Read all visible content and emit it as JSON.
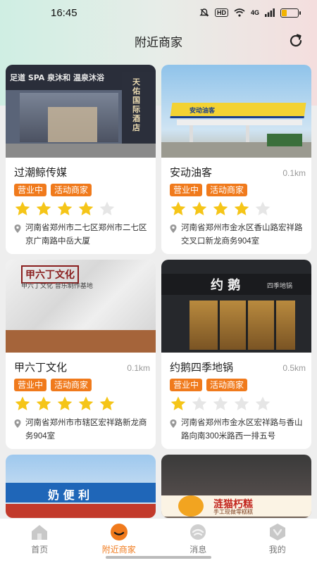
{
  "status_bar": {
    "time": "16:45",
    "hd": "HD",
    "network": "4G"
  },
  "header": {
    "title": "附近商家"
  },
  "merchants": [
    {
      "name": "过潮鲸传媒",
      "distance": "",
      "tags": [
        "营业中",
        "活动商家"
      ],
      "rating": 4,
      "address": "河南省郑州市二七区郑州市二七区京广南路中岳大厦"
    },
    {
      "name": "安动油客",
      "distance": "0.1km",
      "tags": [
        "营业中",
        "活动商家"
      ],
      "rating": 4,
      "address": "河南省郑州市金水区香山路宏祥路交叉口新龙商务904室"
    },
    {
      "name": "甲六丁文化",
      "distance": "0.1km",
      "tags": [
        "营业中",
        "活动商家"
      ],
      "rating": 5,
      "address": "河南省郑州市市辖区宏祥路新龙商务904室"
    },
    {
      "name": "约鹅四季地锅",
      "distance": "0.5km",
      "tags": [
        "营业中",
        "活动商家"
      ],
      "rating": 1,
      "address": "河南省郑州市金水区宏祥路与香山路向南300米路西一排五号"
    }
  ],
  "signs": {
    "m1_top": "足道 SPA 泉沐和 温泉沐浴",
    "m1_side": "天佑国际酒店",
    "m2_canopy": "安动油客",
    "m3_logo": "甲六丁文化",
    "m3_sub": "甲六丁文化 音乐制作基地",
    "m4_main": "约 鹅",
    "m4_sub": "四季地锅",
    "m5": "奶 便 利",
    "m6": "涟猫朽糕",
    "m6_sub": "手工现做零糕糕"
  },
  "tabs": [
    {
      "label": "首页",
      "icon": "home-icon",
      "active": false
    },
    {
      "label": "附近商家",
      "icon": "nearby-icon",
      "active": true
    },
    {
      "label": "消息",
      "icon": "message-icon",
      "active": false
    },
    {
      "label": "我的",
      "icon": "profile-icon",
      "active": false
    }
  ],
  "colors": {
    "accent": "#f07a1c",
    "star_on": "#f5c518",
    "star_off": "#e6e6e6"
  }
}
